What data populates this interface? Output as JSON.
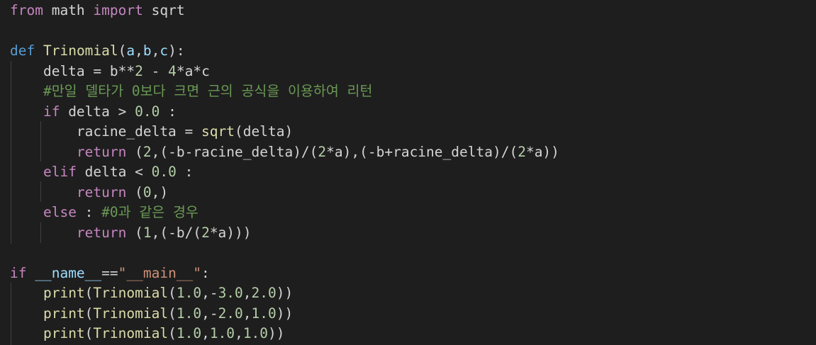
{
  "lines": [
    [
      {
        "t": "from",
        "c": "kw"
      },
      {
        "t": " math ",
        "c": "pl"
      },
      {
        "t": "import",
        "c": "kw"
      },
      {
        "t": " sqrt",
        "c": "pl"
      }
    ],
    [],
    [
      {
        "t": "def",
        "c": "def"
      },
      {
        "t": " ",
        "c": "pl"
      },
      {
        "t": "Trinomial",
        "c": "fn"
      },
      {
        "t": "(",
        "c": "pl"
      },
      {
        "t": "a",
        "c": "var"
      },
      {
        "t": ",",
        "c": "pl"
      },
      {
        "t": "b",
        "c": "var"
      },
      {
        "t": ",",
        "c": "pl"
      },
      {
        "t": "c",
        "c": "var"
      },
      {
        "t": "):",
        "c": "pl"
      }
    ],
    [
      {
        "t": "    delta = b**",
        "c": "pl"
      },
      {
        "t": "2",
        "c": "num"
      },
      {
        "t": " - ",
        "c": "pl"
      },
      {
        "t": "4",
        "c": "num"
      },
      {
        "t": "*a*c",
        "c": "pl"
      }
    ],
    [
      {
        "t": "    ",
        "c": "pl"
      },
      {
        "t": "#만일 델타가 0보다 크면 근의 공식을 이용하여 리턴",
        "c": "cm"
      }
    ],
    [
      {
        "t": "    ",
        "c": "pl"
      },
      {
        "t": "if",
        "c": "kw"
      },
      {
        "t": " delta > ",
        "c": "pl"
      },
      {
        "t": "0.0",
        "c": "num"
      },
      {
        "t": " :",
        "c": "pl"
      }
    ],
    [
      {
        "t": "        racine_delta = ",
        "c": "pl"
      },
      {
        "t": "sqrt",
        "c": "fn"
      },
      {
        "t": "(delta)",
        "c": "pl"
      }
    ],
    [
      {
        "t": "        ",
        "c": "pl"
      },
      {
        "t": "return",
        "c": "kw"
      },
      {
        "t": " (",
        "c": "pl"
      },
      {
        "t": "2",
        "c": "num"
      },
      {
        "t": ",(-b-racine_delta)/(",
        "c": "pl"
      },
      {
        "t": "2",
        "c": "num"
      },
      {
        "t": "*a),(-b+racine_delta)/(",
        "c": "pl"
      },
      {
        "t": "2",
        "c": "num"
      },
      {
        "t": "*a))",
        "c": "pl"
      }
    ],
    [
      {
        "t": "    ",
        "c": "pl"
      },
      {
        "t": "elif",
        "c": "kw"
      },
      {
        "t": " delta < ",
        "c": "pl"
      },
      {
        "t": "0.0",
        "c": "num"
      },
      {
        "t": " :",
        "c": "pl"
      }
    ],
    [
      {
        "t": "        ",
        "c": "pl"
      },
      {
        "t": "return",
        "c": "kw"
      },
      {
        "t": " (",
        "c": "pl"
      },
      {
        "t": "0",
        "c": "num"
      },
      {
        "t": ",)",
        "c": "pl"
      }
    ],
    [
      {
        "t": "    ",
        "c": "pl"
      },
      {
        "t": "else",
        "c": "kw"
      },
      {
        "t": " : ",
        "c": "pl"
      },
      {
        "t": "#0과 같은 경우",
        "c": "cm"
      }
    ],
    [
      {
        "t": "        ",
        "c": "pl"
      },
      {
        "t": "return",
        "c": "kw"
      },
      {
        "t": " (",
        "c": "pl"
      },
      {
        "t": "1",
        "c": "num"
      },
      {
        "t": ",(-b/(",
        "c": "pl"
      },
      {
        "t": "2",
        "c": "num"
      },
      {
        "t": "*a)))",
        "c": "pl"
      }
    ],
    [],
    [
      {
        "t": "if",
        "c": "kw"
      },
      {
        "t": " ",
        "c": "pl"
      },
      {
        "t": "__name__",
        "c": "var"
      },
      {
        "t": "==",
        "c": "pl"
      },
      {
        "t": "\"__main__\"",
        "c": "str"
      },
      {
        "t": ":",
        "c": "pl"
      }
    ],
    [
      {
        "t": "    ",
        "c": "pl"
      },
      {
        "t": "print",
        "c": "fn"
      },
      {
        "t": "(",
        "c": "pl"
      },
      {
        "t": "Trinomial",
        "c": "fn"
      },
      {
        "t": "(",
        "c": "pl"
      },
      {
        "t": "1.0",
        "c": "num"
      },
      {
        "t": ",-",
        "c": "pl"
      },
      {
        "t": "3.0",
        "c": "num"
      },
      {
        "t": ",",
        "c": "pl"
      },
      {
        "t": "2.0",
        "c": "num"
      },
      {
        "t": "))",
        "c": "pl"
      }
    ],
    [
      {
        "t": "    ",
        "c": "pl"
      },
      {
        "t": "print",
        "c": "fn"
      },
      {
        "t": "(",
        "c": "pl"
      },
      {
        "t": "Trinomial",
        "c": "fn"
      },
      {
        "t": "(",
        "c": "pl"
      },
      {
        "t": "1.0",
        "c": "num"
      },
      {
        "t": ",-",
        "c": "pl"
      },
      {
        "t": "2.0",
        "c": "num"
      },
      {
        "t": ",",
        "c": "pl"
      },
      {
        "t": "1.0",
        "c": "num"
      },
      {
        "t": "))",
        "c": "pl"
      }
    ],
    [
      {
        "t": "    ",
        "c": "pl"
      },
      {
        "t": "print",
        "c": "fn"
      },
      {
        "t": "(",
        "c": "pl"
      },
      {
        "t": "Trinomial",
        "c": "fn"
      },
      {
        "t": "(",
        "c": "pl"
      },
      {
        "t": "1.0",
        "c": "num"
      },
      {
        "t": ",",
        "c": "pl"
      },
      {
        "t": "1.0",
        "c": "num"
      },
      {
        "t": ",",
        "c": "pl"
      },
      {
        "t": "1.0",
        "c": "num"
      },
      {
        "t": "))",
        "c": "pl"
      }
    ]
  ],
  "colors": {
    "background": "#1e1e1e",
    "keyword": "#c586c0",
    "def_keyword": "#569cd6",
    "function": "#dcdcaa",
    "variable": "#9cdcfe",
    "number": "#b5cea8",
    "string": "#ce9178",
    "comment": "#6a9955",
    "plain": "#d4d4d4"
  }
}
